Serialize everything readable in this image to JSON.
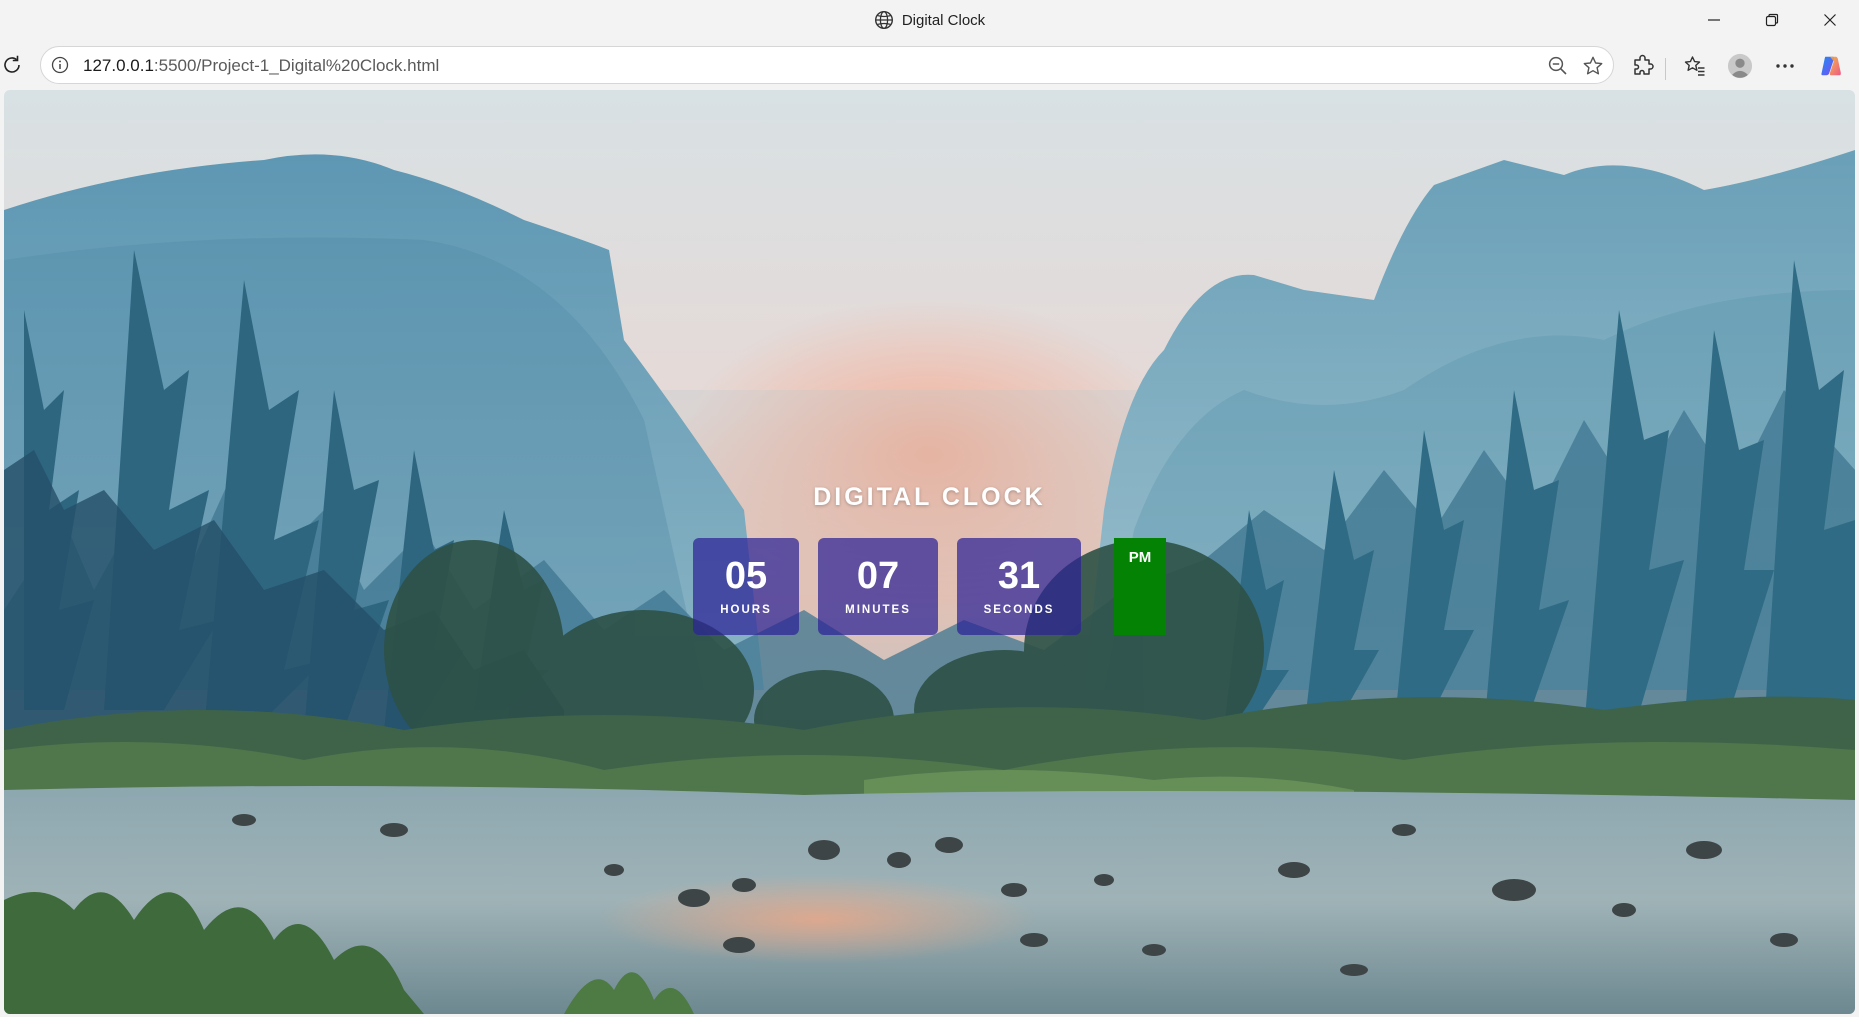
{
  "window": {
    "title": "Digital Clock",
    "icons": [
      "globe-icon",
      "minimize-icon",
      "restore-icon",
      "close-icon"
    ]
  },
  "toolbar": {
    "url_host": "127.0.0.1",
    "url_rest": ":5500/Project-1_Digital%20Clock.html",
    "icons": [
      "reload-icon",
      "site-info-icon",
      "zoom-out-icon",
      "favorite-star-icon",
      "extensions-icon",
      "favorites-icon",
      "profile-avatar-icon",
      "more-options-icon",
      "copilot-icon"
    ]
  },
  "clock": {
    "title": "DIGITAL CLOCK",
    "hours": {
      "value": "05",
      "label": "HOURS"
    },
    "minutes": {
      "value": "07",
      "label": "MINUTES"
    },
    "seconds": {
      "value": "31",
      "label": "SECONDS"
    },
    "ampm": "PM",
    "colors": {
      "box": "#2d2396",
      "ampm": "#038203",
      "text": "#ffffff"
    }
  }
}
